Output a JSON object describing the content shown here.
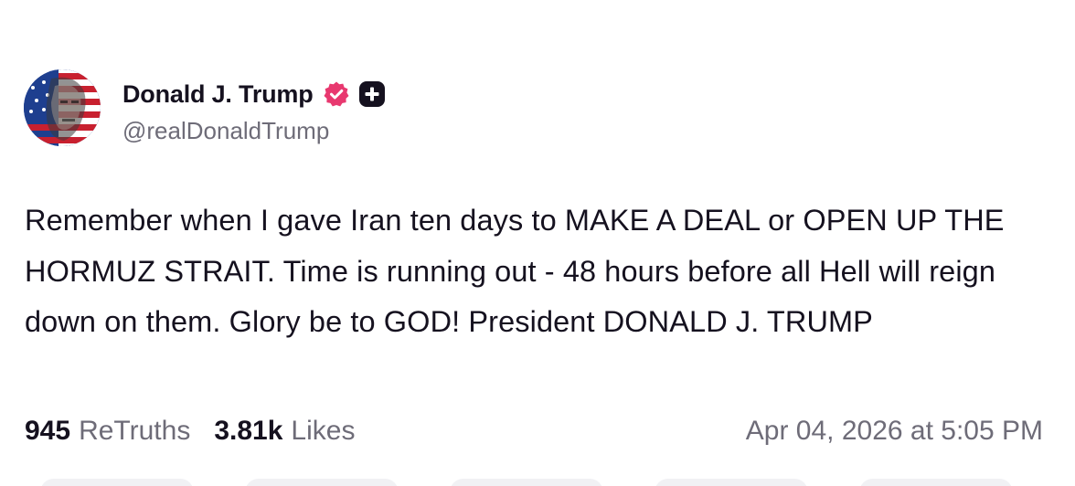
{
  "author": {
    "display_name": "Donald J. Trump",
    "handle": "@realDonaldTrump",
    "avatar_icon": "flag-portrait-avatar",
    "verified_icon": "verified-badge-icon",
    "plus_icon": "plus-badge-icon"
  },
  "post": {
    "text": "Remember when I gave Iran ten days to MAKE A DEAL or OPEN UP THE HORMUZ STRAIT. Time is running out - 48 hours before all Hell will reign down on them. Glory be to GOD! President DONALD J. TRUMP"
  },
  "stats": {
    "retruths_count": "945",
    "retruths_label": "ReTruths",
    "likes_count": "3.81k",
    "likes_label": "Likes",
    "timestamp": "Apr 04, 2026 at 5:05 PM"
  },
  "colors": {
    "text": "#15111f",
    "muted": "#6e6c78",
    "verified": "#e8386f",
    "badge_dark": "#15111f",
    "action_bg": "#f1f1f4"
  }
}
